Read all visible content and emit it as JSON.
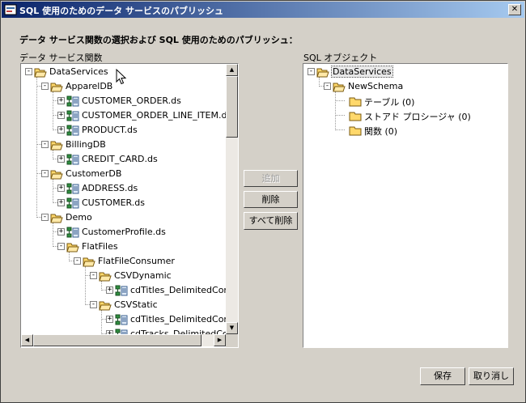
{
  "window": {
    "title": "SQL 使用のためのデータ サービスのパブリッシュ",
    "close_glyph": "✕"
  },
  "instruction": "データ サービス関数の選択および SQL 使用のためのパブリッシュ：",
  "left_panel": {
    "label": "データ サービス関数",
    "tree": [
      {
        "text": "DataServices",
        "depth": 0,
        "expander": "-",
        "icon": "folder-open-icon"
      },
      {
        "text": "ApparelDB",
        "depth": 1,
        "expander": "-",
        "icon": "folder-open-icon"
      },
      {
        "text": "CUSTOMER_ORDER.ds",
        "depth": 2,
        "expander": "+",
        "icon": "dataservice-icon"
      },
      {
        "text": "CUSTOMER_ORDER_LINE_ITEM.ds",
        "depth": 2,
        "expander": "+",
        "icon": "dataservice-icon"
      },
      {
        "text": "PRODUCT.ds",
        "depth": 2,
        "expander": "+",
        "icon": "dataservice-icon"
      },
      {
        "text": "BillingDB",
        "depth": 1,
        "expander": "-",
        "icon": "folder-open-icon"
      },
      {
        "text": "CREDIT_CARD.ds",
        "depth": 2,
        "expander": "+",
        "icon": "dataservice-icon"
      },
      {
        "text": "CustomerDB",
        "depth": 1,
        "expander": "-",
        "icon": "folder-open-icon"
      },
      {
        "text": "ADDRESS.ds",
        "depth": 2,
        "expander": "+",
        "icon": "dataservice-icon"
      },
      {
        "text": "CUSTOMER.ds",
        "depth": 2,
        "expander": "+",
        "icon": "dataservice-icon"
      },
      {
        "text": "Demo",
        "depth": 1,
        "expander": "-",
        "icon": "folder-open-icon"
      },
      {
        "text": "CustomerProfile.ds",
        "depth": 2,
        "expander": "+",
        "icon": "dataservice-icon"
      },
      {
        "text": "FlatFiles",
        "depth": 2,
        "expander": "-",
        "icon": "folder-open-icon"
      },
      {
        "text": "FlatFileConsumer",
        "depth": 3,
        "expander": "-",
        "icon": "folder-open-icon"
      },
      {
        "text": "CSVDynamic",
        "depth": 4,
        "expander": "-",
        "icon": "folder-open-icon"
      },
      {
        "text": "cdTitles_DelimitedConsumer.ds",
        "depth": 5,
        "expander": "+",
        "icon": "dataservice-icon"
      },
      {
        "text": "CSVStatic",
        "depth": 4,
        "expander": "-",
        "icon": "folder-open-icon"
      },
      {
        "text": "cdTitles_DelimitedConsumer.ds",
        "depth": 5,
        "expander": "+",
        "icon": "dataservice-icon"
      },
      {
        "text": "cdTracks_DelimitedConsumer.ds",
        "depth": 5,
        "expander": "+",
        "icon": "dataservice-icon"
      }
    ]
  },
  "right_panel": {
    "label": "SQL オブジェクト",
    "tree": [
      {
        "text": "DataServices",
        "depth": 0,
        "expander": "-",
        "icon": "folder-open-icon",
        "selected": true
      },
      {
        "text": "NewSchema",
        "depth": 1,
        "expander": "-",
        "icon": "folder-open-icon"
      },
      {
        "text": "テーブル (0)",
        "depth": 2,
        "expander": "",
        "icon": "folder-closed-icon"
      },
      {
        "text": "ストアド プロシージャ (0)",
        "depth": 2,
        "expander": "",
        "icon": "folder-closed-icon"
      },
      {
        "text": "関数 (0)",
        "depth": 2,
        "expander": "",
        "icon": "folder-closed-icon"
      }
    ]
  },
  "buttons": {
    "add": "追加",
    "remove": "削除",
    "remove_all": "すべて削除",
    "save": "保存",
    "cancel": "取り消し"
  },
  "scroll_glyphs": {
    "up": "▲",
    "down": "▼",
    "left": "◀",
    "right": "▶"
  },
  "colors": {
    "title_start": "#0a246a",
    "title_end": "#a6caf0",
    "face": "#d4d0c8",
    "folder": "#ffd86b"
  }
}
